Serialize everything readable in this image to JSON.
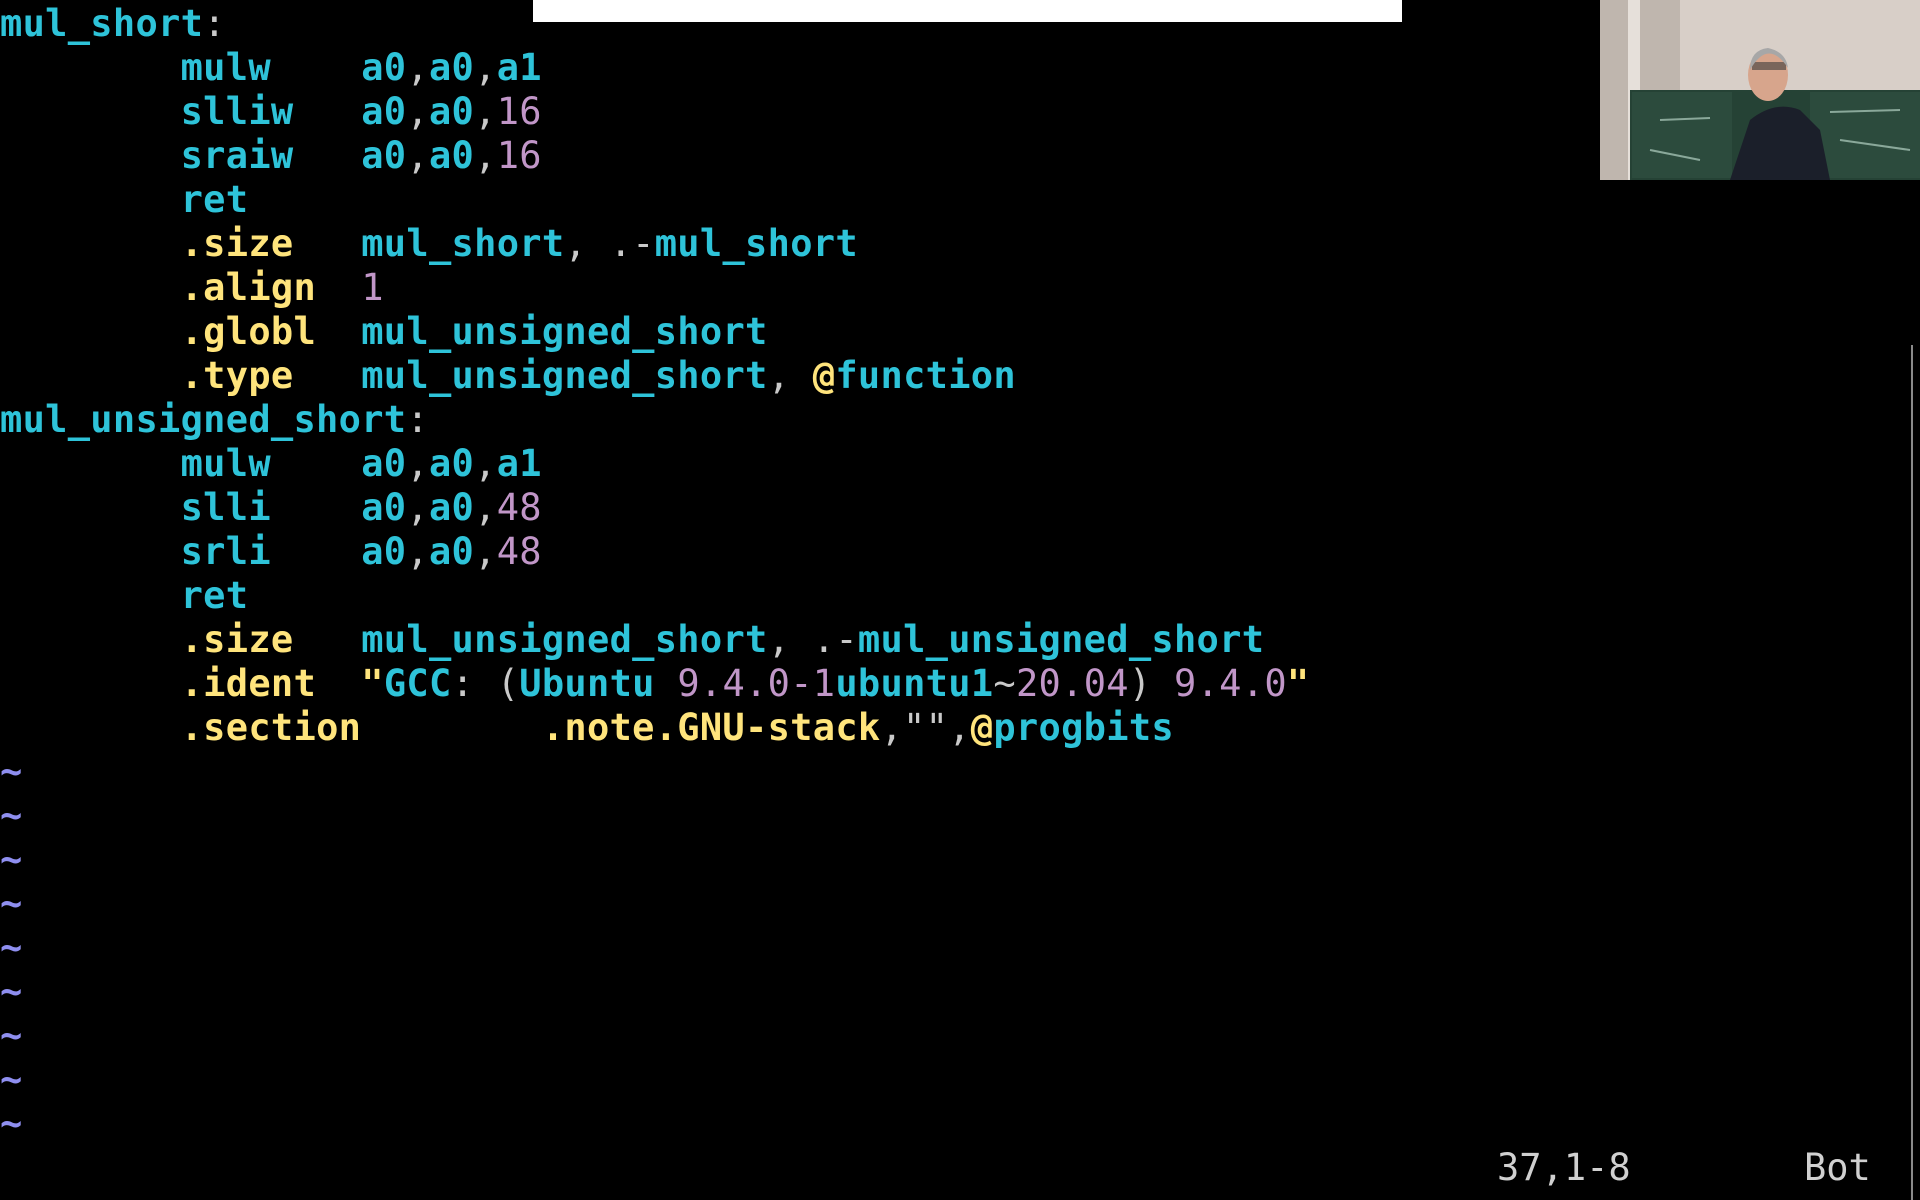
{
  "colors": {
    "background": "#000000",
    "label": "#2ec3d9",
    "instruction": "#2ec3d9",
    "directive": "#ffe47c",
    "number": "#c196c8",
    "punct": "#c9c9c9",
    "string": "#ffe47c",
    "tilde": "#8f8ff0",
    "status": "#d0d0d0"
  },
  "code_lines": [
    [
      {
        "t": "mul_short",
        "c": "label"
      },
      {
        "t": ":",
        "c": "punct"
      }
    ],
    [
      {
        "t": "        "
      },
      {
        "t": "mulw",
        "c": "instruction"
      },
      {
        "t": "    "
      },
      {
        "t": "a0",
        "c": "instruction"
      },
      {
        "t": ",",
        "c": "punct"
      },
      {
        "t": "a0",
        "c": "instruction"
      },
      {
        "t": ",",
        "c": "punct"
      },
      {
        "t": "a1",
        "c": "instruction"
      }
    ],
    [
      {
        "t": "        "
      },
      {
        "t": "slliw",
        "c": "instruction"
      },
      {
        "t": "   "
      },
      {
        "t": "a0",
        "c": "instruction"
      },
      {
        "t": ",",
        "c": "punct"
      },
      {
        "t": "a0",
        "c": "instruction"
      },
      {
        "t": ",",
        "c": "punct"
      },
      {
        "t": "16",
        "c": "number"
      }
    ],
    [
      {
        "t": "        "
      },
      {
        "t": "sraiw",
        "c": "instruction"
      },
      {
        "t": "   "
      },
      {
        "t": "a0",
        "c": "instruction"
      },
      {
        "t": ",",
        "c": "punct"
      },
      {
        "t": "a0",
        "c": "instruction"
      },
      {
        "t": ",",
        "c": "punct"
      },
      {
        "t": "16",
        "c": "number"
      }
    ],
    [
      {
        "t": "        "
      },
      {
        "t": "ret",
        "c": "instruction"
      }
    ],
    [
      {
        "t": "        "
      },
      {
        "t": ".size",
        "c": "directive"
      },
      {
        "t": "   "
      },
      {
        "t": "mul_short",
        "c": "label"
      },
      {
        "t": ", .-",
        "c": "punct"
      },
      {
        "t": "mul_short",
        "c": "label"
      }
    ],
    [
      {
        "t": "        "
      },
      {
        "t": ".align",
        "c": "directive"
      },
      {
        "t": "  "
      },
      {
        "t": "1",
        "c": "number"
      }
    ],
    [
      {
        "t": "        "
      },
      {
        "t": ".globl",
        "c": "directive"
      },
      {
        "t": "  "
      },
      {
        "t": "mul_unsigned_short",
        "c": "label"
      }
    ],
    [
      {
        "t": "        "
      },
      {
        "t": ".type",
        "c": "directive"
      },
      {
        "t": "   "
      },
      {
        "t": "mul_unsigned_short",
        "c": "label"
      },
      {
        "t": ", ",
        "c": "punct"
      },
      {
        "t": "@",
        "c": "directive"
      },
      {
        "t": "function",
        "c": "label"
      }
    ],
    [
      {
        "t": "mul_unsigned_short",
        "c": "label"
      },
      {
        "t": ":",
        "c": "punct"
      }
    ],
    [
      {
        "t": "        "
      },
      {
        "t": "mulw",
        "c": "instruction"
      },
      {
        "t": "    "
      },
      {
        "t": "a0",
        "c": "instruction"
      },
      {
        "t": ",",
        "c": "punct"
      },
      {
        "t": "a0",
        "c": "instruction"
      },
      {
        "t": ",",
        "c": "punct"
      },
      {
        "t": "a1",
        "c": "instruction"
      }
    ],
    [
      {
        "t": "        "
      },
      {
        "t": "slli",
        "c": "instruction"
      },
      {
        "t": "    "
      },
      {
        "t": "a0",
        "c": "instruction"
      },
      {
        "t": ",",
        "c": "punct"
      },
      {
        "t": "a0",
        "c": "instruction"
      },
      {
        "t": ",",
        "c": "punct"
      },
      {
        "t": "48",
        "c": "number"
      }
    ],
    [
      {
        "t": "        "
      },
      {
        "t": "srli",
        "c": "instruction"
      },
      {
        "t": "    "
      },
      {
        "t": "a0",
        "c": "instruction"
      },
      {
        "t": ",",
        "c": "punct"
      },
      {
        "t": "a0",
        "c": "instruction"
      },
      {
        "t": ",",
        "c": "punct"
      },
      {
        "t": "48",
        "c": "number"
      }
    ],
    [
      {
        "t": "        "
      },
      {
        "t": "ret",
        "c": "instruction"
      }
    ],
    [
      {
        "t": "        "
      },
      {
        "t": ".size",
        "c": "directive"
      },
      {
        "t": "   "
      },
      {
        "t": "mul_unsigned_short",
        "c": "label"
      },
      {
        "t": ", .-",
        "c": "punct"
      },
      {
        "t": "mul_unsigned_short",
        "c": "label"
      }
    ],
    [
      {
        "t": "        "
      },
      {
        "t": ".ident",
        "c": "directive"
      },
      {
        "t": "  "
      },
      {
        "t": "\"",
        "c": "string"
      },
      {
        "t": "GCC",
        "c": "label"
      },
      {
        "t": ": (",
        "c": "punct"
      },
      {
        "t": "Ubuntu",
        "c": "label"
      },
      {
        "t": " "
      },
      {
        "t": "9.4.0-1",
        "c": "number"
      },
      {
        "t": "ubuntu1",
        "c": "label"
      },
      {
        "t": "~",
        "c": "punct"
      },
      {
        "t": "20.04",
        "c": "number"
      },
      {
        "t": ") ",
        "c": "punct"
      },
      {
        "t": "9.4.0",
        "c": "number"
      },
      {
        "t": "\"",
        "c": "string"
      }
    ],
    [
      {
        "t": "        "
      },
      {
        "t": ".section",
        "c": "directive"
      },
      {
        "t": "        "
      },
      {
        "t": ".note.GNU-stack",
        "c": "directive"
      },
      {
        "t": ",\"\",",
        "c": "punct"
      },
      {
        "t": "@",
        "c": "directive"
      },
      {
        "t": "progbits",
        "c": "label"
      }
    ]
  ],
  "empty_line_markers": [
    "~",
    "~",
    "~",
    "~",
    "~",
    "~",
    "~",
    "~",
    "~"
  ],
  "status_bar": {
    "position": "37,1-8",
    "scroll": "Bot"
  }
}
